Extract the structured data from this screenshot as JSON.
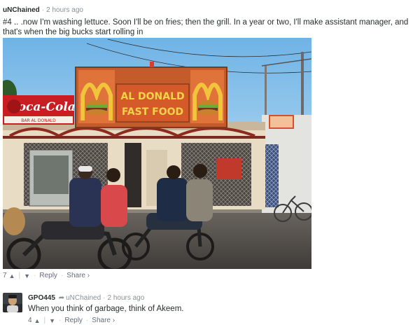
{
  "comments": [
    {
      "author": "uNChained",
      "time": "2 hours ago",
      "text": "#4 .. .now I'm washing lettuce. Soon I'll be on fries; then the grill. In a year or two, I'll make assistant manager, and that's when the big bucks start rolling in",
      "image": {
        "sign_main_line1": "AL DONALD",
        "sign_main_line2": "FAST FOOD",
        "sign_side_brand": "Coca-Cola",
        "sign_side_sub": "BAR AL DONALD"
      },
      "votes": "7",
      "reply_label": "Reply",
      "share_label": "Share ›"
    },
    {
      "author": "GPO445",
      "reply_to": "uNChained",
      "time": "2 hours ago",
      "text": "When you think of garbage, think of Akeem.",
      "votes": "4",
      "reply_label": "Reply",
      "share_label": "Share ›"
    }
  ],
  "colors": {
    "sky": "#8ec3ea",
    "sign_red": "#d8502a",
    "sign_yellow": "#f0c43a",
    "wall": "#e8dcc7",
    "road": "#585450",
    "coke_red": "#c91d22"
  },
  "icons": {
    "upvote": "caret-up-icon",
    "downvote": "caret-down-icon",
    "reply_arrow": "reply-arrow-icon"
  }
}
